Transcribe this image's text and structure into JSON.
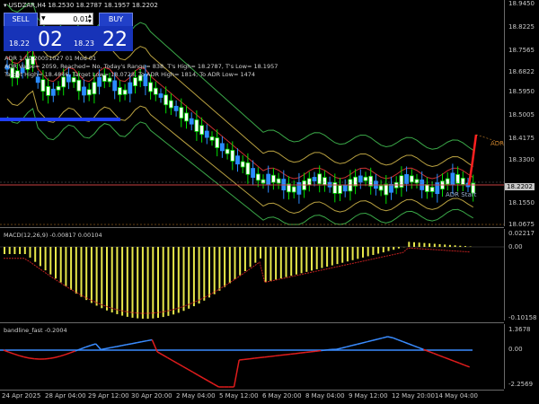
{
  "window": {
    "title": "USDZAR,H4",
    "ohlc": "18.2530 18.2787 18.1957 18.2202"
  },
  "trade": {
    "sell_label": "SELL",
    "buy_label": "BUY",
    "lot": "0.01",
    "sell_small": "18.22",
    "sell_big": "02",
    "buy_small": "18.23",
    "buy_big": "22"
  },
  "adr": {
    "line1": "ADR 1.00 20051027 01 Mod 01",
    "line2": "ADR Value= 2059, Reached= No, Today's Range= 838, T's High= 18.2787, T's Low= 18.1957",
    "line3": "Target High= 18.4846, Target Low= 18.0728, To ADR High= 1814, To ADR Low= 1474",
    "label_right": "ADR",
    "label_start": "ADR Start"
  },
  "macd": {
    "label": "MACD(12,26,9) -0.00817 0.00104"
  },
  "bandline": {
    "label": "bandline_fast -0.2004"
  },
  "price_axis": [
    "18.9450",
    "18.8225",
    "18.7565",
    "18.6822",
    "18.5950",
    "18.5005",
    "18.4175",
    "18.3300",
    "18.2202",
    "18.1550",
    "18.0675"
  ],
  "current_price": "18.2202",
  "macd_axis": [
    "0.02217",
    "0.00",
    "-0.10158"
  ],
  "band_axis": [
    "1.3678",
    "0.00",
    "-2.2569"
  ],
  "time_axis": [
    "24 Apr 2025",
    "28 Apr 04:00",
    "29 Apr 12:00",
    "30 Apr 20:00",
    "2 May 04:00",
    "5 May 12:00",
    "6 May 20:00",
    "8 May 04:00",
    "9 May 12:00",
    "12 May 20:00",
    "14 May 04:00"
  ],
  "colors": {
    "bg": "#000000",
    "bull": "#00e000",
    "bear": "#2a8cff",
    "macd_hist": "#e8e84a",
    "macd_signal": "#c02020",
    "band_up": "#3a8cff",
    "band_down": "#e01c1c",
    "price_line": "#c84040",
    "ma_inner": "#b8a040",
    "ma_outer": "#3aa848",
    "ma_mid": "#c83030",
    "adr_blue": "#2040ff"
  }
}
